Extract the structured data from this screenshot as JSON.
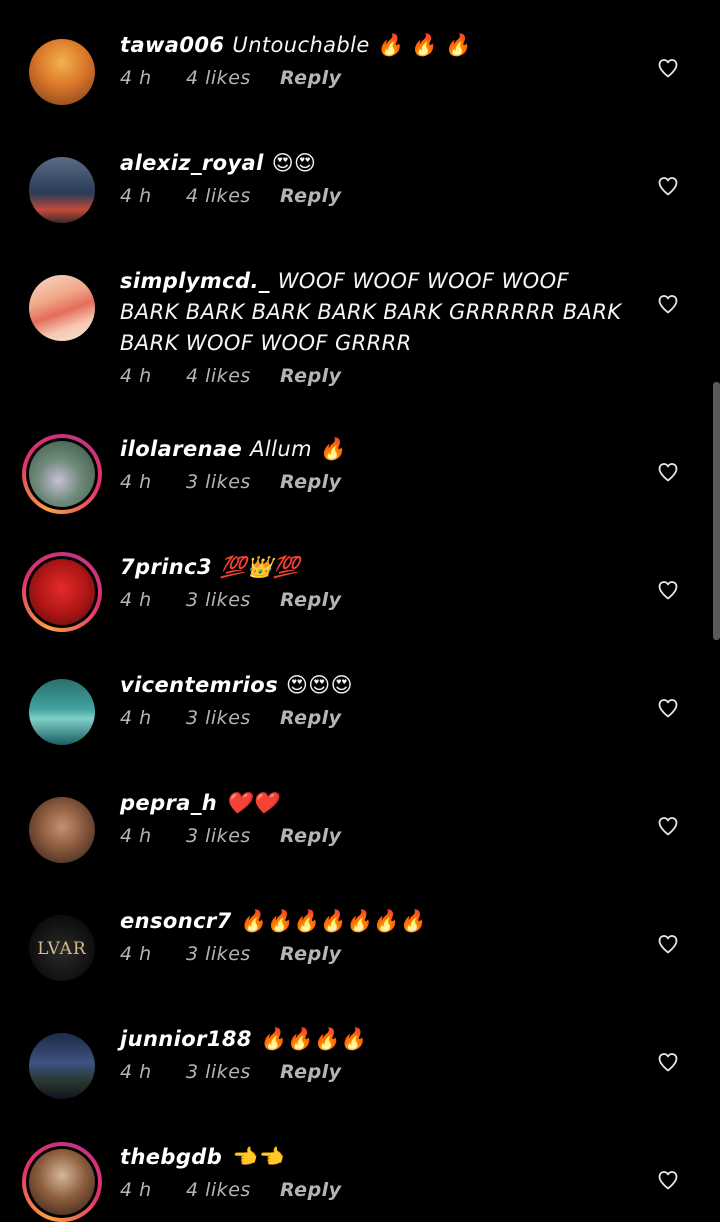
{
  "comments": [
    {
      "username": "tawa006",
      "text": "Untouchable 🔥 🔥 🔥",
      "time": "4 h",
      "likes": "4 likes",
      "reply": "Reply",
      "avatar": "av-tawa",
      "story_ring": false
    },
    {
      "username": "alexiz_royal",
      "text": "😍😍",
      "time": "4 h",
      "likes": "4 likes",
      "reply": "Reply",
      "avatar": "av-alexiz",
      "story_ring": false
    },
    {
      "username": "simplymcd._",
      "text": "WOOF WOOF WOOF WOOF BARK BARK BARK BARK BARK GRRRRRR BARK BARK WOOF WOOF GRRRR",
      "time": "4 h",
      "likes": "4 likes",
      "reply": "Reply",
      "avatar": "av-simply",
      "story_ring": false
    },
    {
      "username": "ilolarenae",
      "text": "Allum 🔥",
      "time": "4 h",
      "likes": "3 likes",
      "reply": "Reply",
      "avatar": "av-ilola",
      "story_ring": true
    },
    {
      "username": "7princ3",
      "text": "💯👑💯",
      "time": "4 h",
      "likes": "3 likes",
      "reply": "Reply",
      "avatar": "av-7princ",
      "story_ring": true
    },
    {
      "username": "vicentemrios",
      "text": "😍😍😍",
      "time": "4 h",
      "likes": "3 likes",
      "reply": "Reply",
      "avatar": "av-vicente",
      "story_ring": false
    },
    {
      "username": "pepra_h",
      "text": "❤️❤️",
      "time": "4 h",
      "likes": "3 likes",
      "reply": "Reply",
      "avatar": "av-pepra",
      "story_ring": false
    },
    {
      "username": "ensoncr7",
      "text": "🔥🔥🔥🔥🔥🔥🔥",
      "time": "4 h",
      "likes": "3 likes",
      "reply": "Reply",
      "avatar": "av-enson",
      "story_ring": false
    },
    {
      "username": "junnior188",
      "text": "🔥🔥🔥🔥",
      "time": "4 h",
      "likes": "3 likes",
      "reply": "Reply",
      "avatar": "av-junnior",
      "story_ring": false
    },
    {
      "username": "thebgdb",
      "text": "👈👈",
      "time": "4 h",
      "likes": "4 likes",
      "reply": "Reply",
      "avatar": "av-thebg",
      "story_ring": true
    }
  ],
  "avatar_text": {
    "ensoncr7": "LVAR"
  },
  "icons": {
    "like": "heart-outline-icon"
  },
  "colors": {
    "background": "#000000",
    "username": "#ffffff",
    "meta": "#b4b4b4",
    "story_ring": [
      "#f9a03f",
      "#e1306c",
      "#c13584"
    ]
  }
}
